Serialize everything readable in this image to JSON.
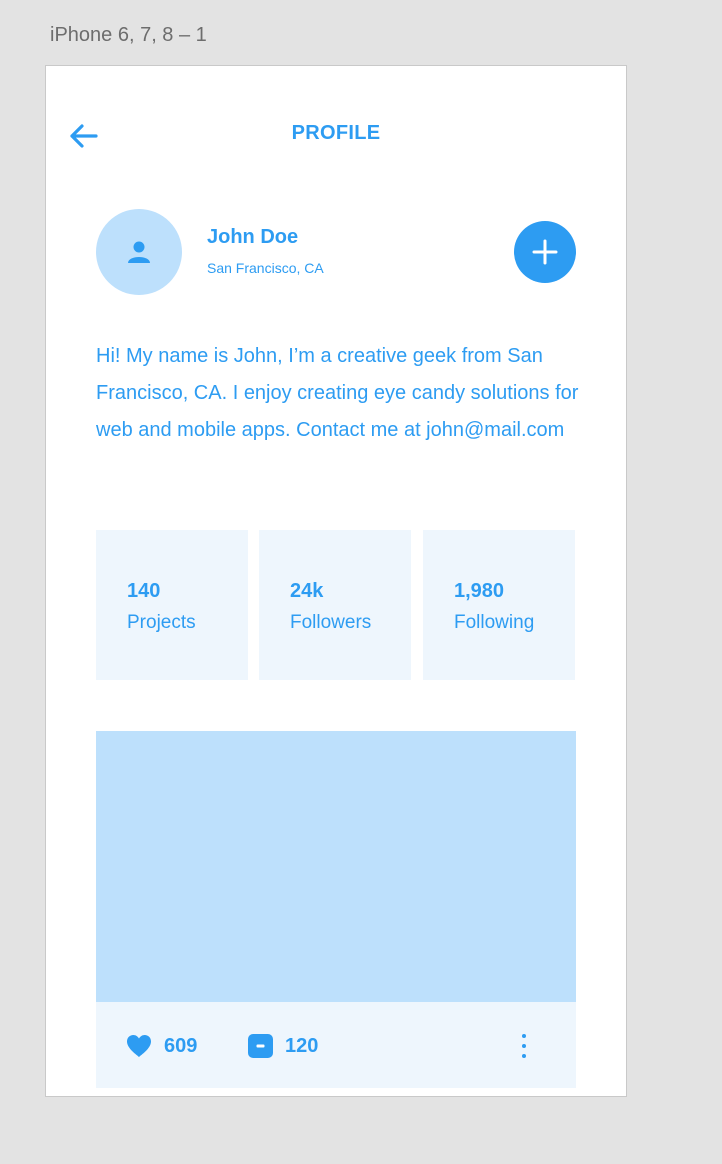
{
  "artboard": {
    "label": "iPhone 6, 7, 8 – 1"
  },
  "header": {
    "title": "PROFILE",
    "back_icon": "arrow-left-icon"
  },
  "profile": {
    "name": "John Doe",
    "location": "San Francisco, CA",
    "avatar_icon": "user-icon",
    "add_icon": "plus-icon",
    "bio": "Hi! My name is John, I’m a creative geek from San Francisco, CA. I enjoy creating eye candy solutions for web and mobile apps. Contact me at john@mail.com"
  },
  "stats": [
    {
      "value": "140",
      "label": "Projects"
    },
    {
      "value": "24k",
      "label": "Followers"
    },
    {
      "value": "1,980",
      "label": "Following"
    }
  ],
  "post": {
    "likes": "609",
    "comments": "120",
    "like_icon": "heart-icon",
    "comment_icon": "comment-icon",
    "more_icon": "more-vertical-icon"
  },
  "colors": {
    "accent": "#2d9cf2",
    "light_accent": "#bde0fc",
    "panel": "#eef6fd",
    "canvas": "#e3e3e3"
  }
}
